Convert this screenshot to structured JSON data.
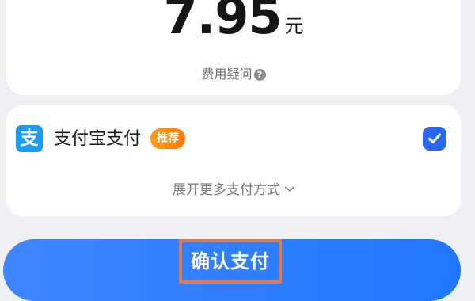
{
  "fee": {
    "amount": "7.95",
    "unit": "元",
    "question_label": "费用疑问",
    "help_icon": "question-circle-icon",
    "help_glyph": "?"
  },
  "payment": {
    "method_icon": "alipay-icon",
    "method_icon_glyph": "支",
    "method_name": "支付宝支付",
    "badge": "推荐",
    "selected": true,
    "expand_label": "展开更多支付方式",
    "expand_icon": "chevron-down-icon"
  },
  "confirm": {
    "label": "确认支付"
  },
  "colors": {
    "accent": "#2a67f0",
    "button": "#2f7cff",
    "badge": "#ff8c0f",
    "alipay": "#1a9cf0",
    "highlight_box": "#e07a4e"
  }
}
